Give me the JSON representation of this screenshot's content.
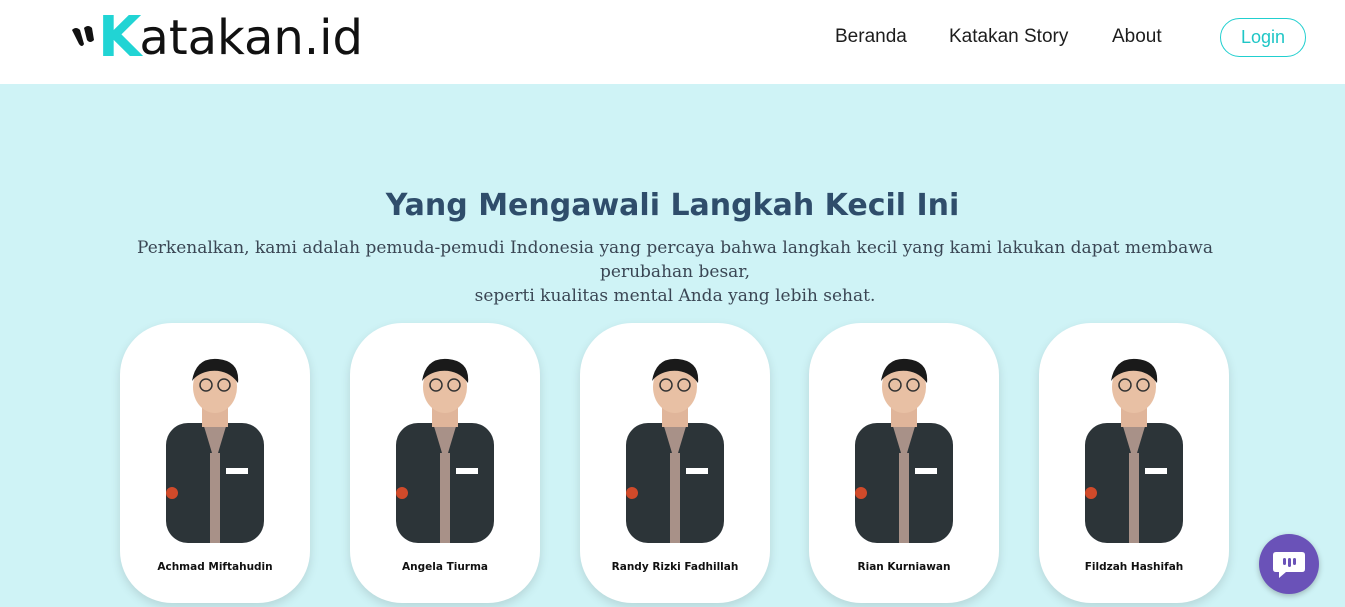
{
  "brand": {
    "logo_k": "K",
    "logo_rest": "atakan.id",
    "accent_color": "#21d4d4"
  },
  "nav": {
    "items": [
      {
        "label": "Beranda"
      },
      {
        "label": "Katakan Story"
      },
      {
        "label": "About"
      }
    ],
    "login_label": "Login"
  },
  "hero": {
    "title": "Yang Mengawali Langkah Kecil Ini",
    "subtitle_line1": "Perkenalkan, kami adalah pemuda-pemudi Indonesia yang percaya bahwa langkah kecil yang kami lakukan dapat membawa perubahan besar,",
    "subtitle_line2": "seperti kualitas mental Anda yang lebih sehat."
  },
  "team": [
    {
      "name": "Achmad Miftahudin"
    },
    {
      "name": "Angela Tiurma"
    },
    {
      "name": "Randy Rizki Fadhillah"
    },
    {
      "name": "Rian Kurniawan"
    },
    {
      "name": "Fildzah Hashifah"
    }
  ],
  "chat": {
    "icon": "chat-bubble-icon",
    "color": "#6a52b8"
  }
}
